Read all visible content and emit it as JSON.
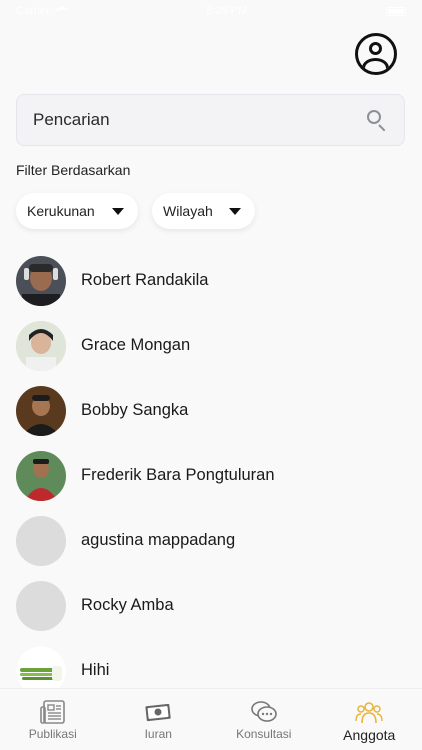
{
  "status_bar": {
    "carrier": "Carrier",
    "time": "8:25 PM"
  },
  "search": {
    "placeholder": "Pencarian",
    "value": ""
  },
  "filter": {
    "label": "Filter Berdasarkan",
    "kerukunan": "Kerukunan",
    "wilayah": "Wilayah"
  },
  "members": [
    {
      "name": "Robert Randakila"
    },
    {
      "name": "Grace Mongan"
    },
    {
      "name": "Bobby Sangka"
    },
    {
      "name": "Frederik Bara Pongtuluran"
    },
    {
      "name": "agustina mappadang"
    },
    {
      "name": "Rocky Amba"
    },
    {
      "name": "Hihi"
    }
  ],
  "nav": {
    "publikasi": "Publikasi",
    "iuran": "Iuran",
    "konsultasi": "Konsultasi",
    "anggota": "Anggota"
  },
  "colors": {
    "accent": "#e8b339",
    "inactive": "#777777",
    "background": "#f9f9f9"
  }
}
